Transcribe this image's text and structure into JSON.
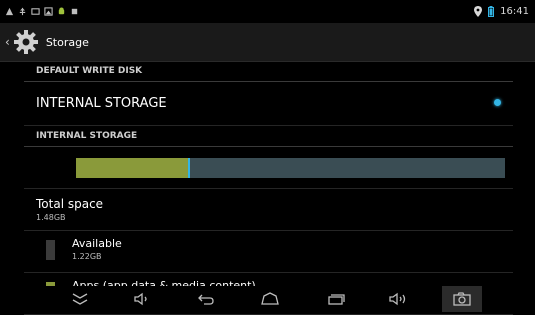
{
  "status_bar": {
    "time": "16:41",
    "left_icons": [
      "warning-icon",
      "usb-icon",
      "storage-icon",
      "image-icon",
      "android-icon",
      "square-icon"
    ],
    "right_icons": [
      "location-icon",
      "battery-icon"
    ]
  },
  "action_bar": {
    "title": "Storage",
    "icon": "gear-icon"
  },
  "default_write_disk": {
    "header": "DEFAULT WRITE DISK",
    "option_label": "INTERNAL STORAGE",
    "selected": true
  },
  "internal_storage": {
    "header": "INTERNAL STORAGE",
    "usage_bar": {
      "used_fraction": 0.26
    },
    "total_space": {
      "label": "Total space",
      "value": "1.48GB"
    },
    "items": [
      {
        "label": "Available",
        "value": "1.22GB",
        "color": "#3b3b3b"
      },
      {
        "label": "Apps (app data & media content)",
        "value": "",
        "color": "#8a9a3a"
      }
    ]
  },
  "colors": {
    "accent": "#33b5e5",
    "usage_apps": "#8a9a3a",
    "usage_bar_bg": "#3a4d54"
  },
  "nav_bar": {
    "buttons": [
      "hide-keyboard-icon",
      "volume-down-icon",
      "back-icon",
      "home-icon",
      "recents-icon",
      "volume-up-icon",
      "screenshot-icon"
    ]
  }
}
